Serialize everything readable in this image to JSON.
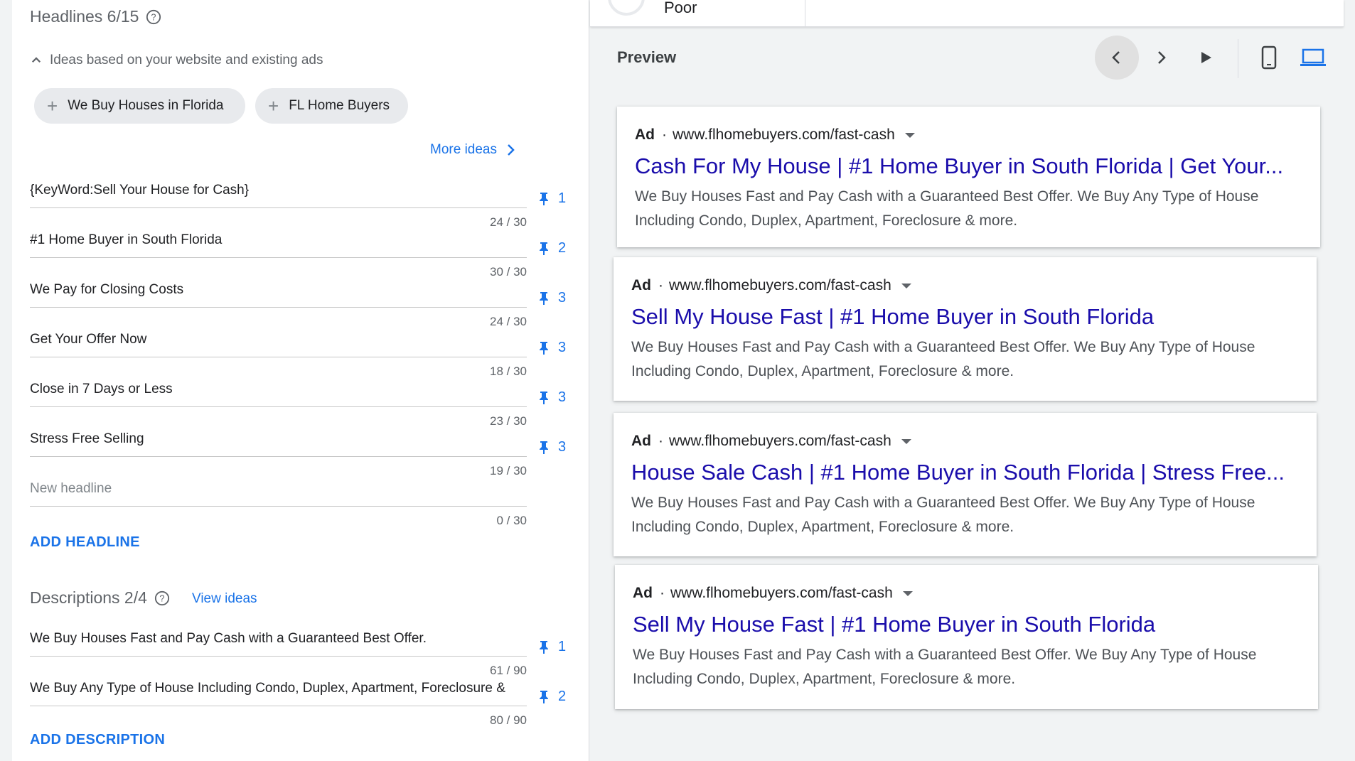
{
  "headlines": {
    "title": "Headlines 6/15",
    "ideas_toggle": "Ideas based on your website and existing ads",
    "chips": [
      "We Buy Houses in Florida",
      "FL Home Buyers"
    ],
    "more_ideas": "More ideas",
    "items": [
      {
        "text": "{KeyWord:Sell Your House for Cash}",
        "counter": "24 / 30",
        "pin": "1"
      },
      {
        "text": "#1 Home Buyer in South Florida",
        "counter": "30 / 30",
        "pin": "2"
      },
      {
        "text": "We Pay for Closing Costs",
        "counter": "24 / 30",
        "pin": "3"
      },
      {
        "text": "Get Your Offer Now",
        "counter": "18 / 30",
        "pin": "3"
      },
      {
        "text": "Close in 7 Days or Less",
        "counter": "23 / 30",
        "pin": "3"
      },
      {
        "text": "Stress Free Selling",
        "counter": "19 / 30",
        "pin": "3"
      }
    ],
    "new_placeholder": "New headline",
    "new_counter": "0 / 30",
    "add_label": "ADD HEADLINE"
  },
  "descriptions": {
    "title": "Descriptions 2/4",
    "view_ideas": "View ideas",
    "items": [
      {
        "text": "We Buy Houses Fast and Pay Cash with a Guaranteed Best Offer.",
        "counter": "61 / 90",
        "pin": "1"
      },
      {
        "text": "We Buy Any Type of House Including Condo, Duplex, Apartment, Foreclosure &",
        "counter": "80 / 90",
        "pin": "2"
      }
    ],
    "add_label": "ADD DESCRIPTION"
  },
  "status": {
    "strength": "Poor"
  },
  "preview": {
    "label": "Preview",
    "icons": [
      "chevron-left-icon",
      "chevron-right-icon",
      "play-icon",
      "mobile-icon",
      "desktop-icon"
    ],
    "accent_color": "#1a73e8",
    "ads": [
      {
        "badge": "Ad",
        "url": "www.flhomebuyers.com/fast-cash",
        "headline": "Cash For My House | #1 Home Buyer in South Florida | Get Your...",
        "description": "We Buy Houses Fast and Pay Cash with a Guaranteed Best Offer. We Buy Any Type of House Including Condo, Duplex, Apartment, Foreclosure & more."
      },
      {
        "badge": "Ad",
        "url": "www.flhomebuyers.com/fast-cash",
        "headline": "Sell My House Fast | #1 Home Buyer in South Florida",
        "description": "We Buy Houses Fast and Pay Cash with a Guaranteed Best Offer. We Buy Any Type of House Including Condo, Duplex, Apartment, Foreclosure & more."
      },
      {
        "badge": "Ad",
        "url": "www.flhomebuyers.com/fast-cash",
        "headline": "House Sale Cash | #1 Home Buyer in South Florida | Stress Free...",
        "description": "We Buy Houses Fast and Pay Cash with a Guaranteed Best Offer. We Buy Any Type of House Including Condo, Duplex, Apartment, Foreclosure & more."
      },
      {
        "badge": "Ad",
        "url": "www.flhomebuyers.com/fast-cash",
        "headline": "Sell My House Fast | #1 Home Buyer in South Florida",
        "description": "We Buy Houses Fast and Pay Cash with a Guaranteed Best Offer. We Buy Any Type of House Including Condo, Duplex, Apartment, Foreclosure & more."
      }
    ]
  }
}
